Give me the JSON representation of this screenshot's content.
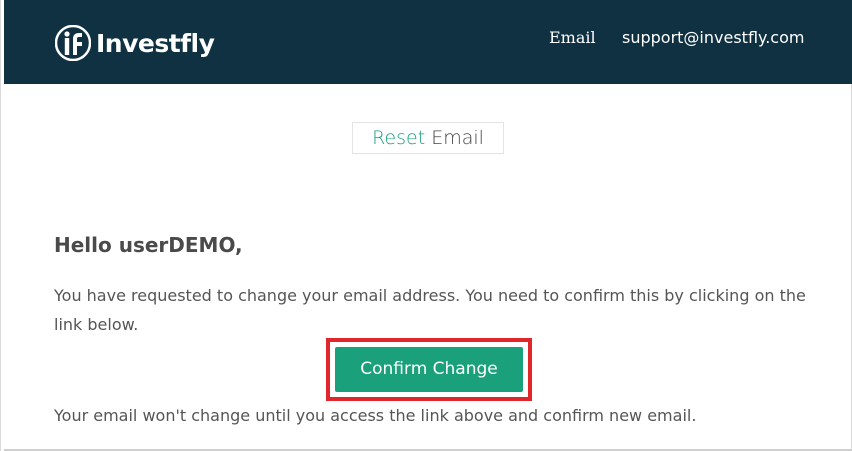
{
  "header": {
    "brand": "Investfly",
    "logo_icon": "investfly-logo-icon",
    "nav_email": "Email",
    "nav_support": "support@investfly.com",
    "background_color": "#0f3142"
  },
  "title": {
    "accent": "Reset",
    "rest": "Email",
    "accent_color": "#1aa07a"
  },
  "body": {
    "greeting": "Hello userDEMO,",
    "message": "You have requested to change your email address. You need to confirm this by clicking on the link below.",
    "button_label": "Confirm Change",
    "button_color": "#1aa07a",
    "highlight_color": "#e0262b",
    "footer_note": "Your email won't change until you access the link above and confirm new email."
  }
}
